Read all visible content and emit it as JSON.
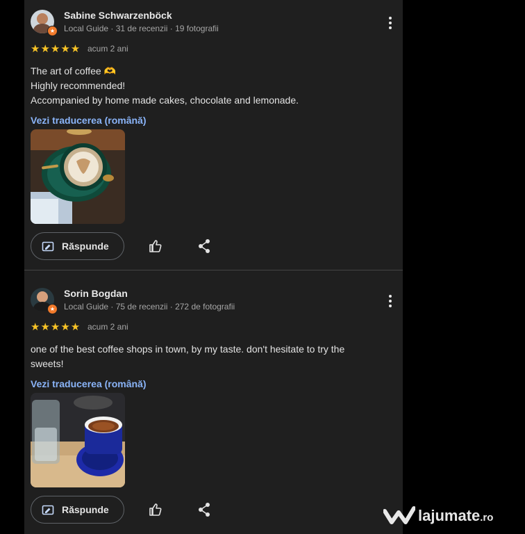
{
  "reviews": [
    {
      "name": "Sabine Schwarzenböck",
      "meta": "Local Guide · 31 de recenzii · 19 fotografii",
      "stars": "★★★★★",
      "rating": 5,
      "time": "acum 2 ani",
      "text_lines": [
        "The art of coffee 🫶",
        "Highly recommended!",
        "Accompanied by home made cakes, chocolate and lemonade."
      ],
      "translate_label": "Vezi traducerea (română)",
      "reply_label": "Răspunde"
    },
    {
      "name": "Sorin Bogdan",
      "meta": "Local Guide · 75 de recenzii · 272 de fotografii",
      "stars": "★★★★★",
      "rating": 5,
      "time": "acum 2 ani",
      "text_lines": [
        "one of the best coffee shops in town, by my taste. don't hesitate to try the",
        "sweets!"
      ],
      "translate_label": "Vezi traducerea (română)",
      "reply_label": "Răspunde"
    }
  ],
  "icons": {
    "more": "more-vert-icon",
    "reply": "reply-edit-icon",
    "like": "thumb-up-icon",
    "share": "share-icon",
    "badge": "local-guide-badge-icon"
  },
  "watermark": {
    "name": "lajumate",
    "tld": ".ro"
  },
  "colors": {
    "background": "#1f1f1f",
    "link": "#8ab4f8",
    "stars": "#f7c326",
    "badge": "#f17a2b"
  }
}
